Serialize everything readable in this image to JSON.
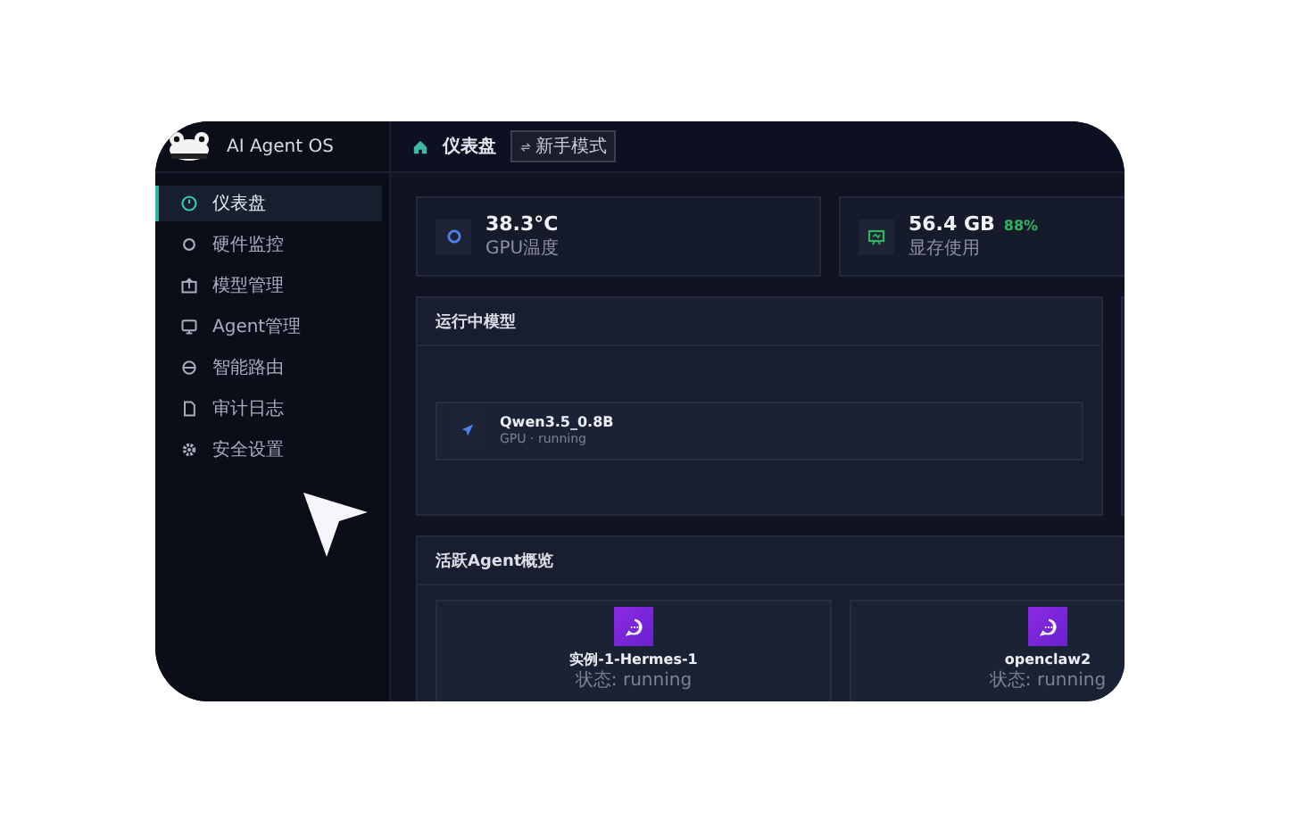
{
  "brand": {
    "title": "AI Agent OS"
  },
  "sidebar": {
    "items": [
      {
        "kind": "gauge",
        "label": "仪表盘",
        "selected": true
      },
      {
        "kind": "chip",
        "label": "硬件监控",
        "selected": false
      },
      {
        "kind": "box",
        "label": "模型管理",
        "selected": false
      },
      {
        "kind": "monitor",
        "label": "Agent管理",
        "selected": false
      },
      {
        "kind": "route",
        "label": "智能路由",
        "selected": false
      },
      {
        "kind": "file",
        "label": "审计日志",
        "selected": false
      },
      {
        "kind": "gear",
        "label": "安全设置",
        "selected": false
      }
    ]
  },
  "header": {
    "breadcrumb": "仪表盘",
    "mode_button": "新手模式"
  },
  "stats": [
    {
      "kind": "chip",
      "value": "38.3°C",
      "label": "GPU温度"
    },
    {
      "kind": "display",
      "value": "56.4 GB",
      "badge": "88%",
      "label": "显存使用"
    }
  ],
  "running_models": {
    "title": "运行中模型",
    "models": [
      {
        "name": "Qwen3.5_0.8B",
        "detail": "GPU · running"
      }
    ]
  },
  "agents": {
    "title": "活跃Agent概览",
    "items": [
      {
        "name": "实例-1-Hermes-1",
        "status": "状态: running"
      },
      {
        "name": "openclaw2",
        "status": "状态: running"
      }
    ]
  }
}
